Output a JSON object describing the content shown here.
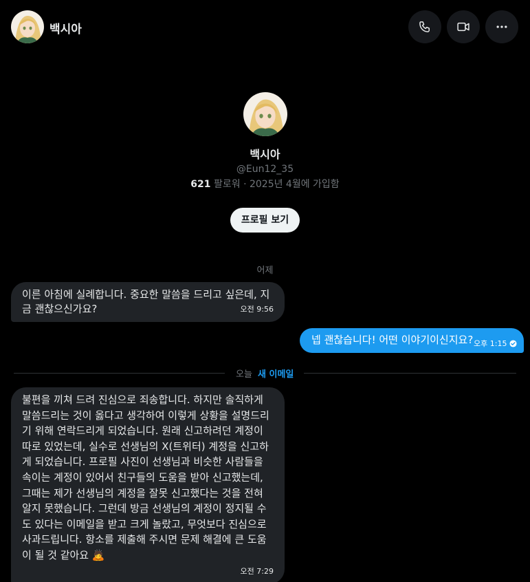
{
  "header": {
    "name": "백시아"
  },
  "profile": {
    "name": "백시아",
    "handle": "@Eun12_35",
    "followers_count": "621",
    "meta_text": "팔로워 · 2025년 4월에 가입함",
    "view_profile_label": "프로필 보기"
  },
  "messages": [
    {
      "date_label": "어제",
      "text": "이른 아침에 실례합니다. 중요한 말씀을 드리고 싶은데, 지금 괜찮으신가요?",
      "time": "오전 9:56",
      "direction": "incoming"
    },
    {
      "text": "넵 괜찮습니다! 어떤 이야기이신지요?",
      "time": "오후 1:15",
      "direction": "outgoing",
      "read": true
    },
    {
      "text": "불편을 끼쳐 드려 진심으로 죄송합니다. 하지만 솔직하게 말씀드리는 것이 옳다고 생각하여 이렇게 상황을 설명드리기 위해 연락드리게 되었습니다. 원래 신고하려던 계정이 따로 있었는데, 실수로 선생님의 X(트위터) 계정을 신고하게 되었습니다. 프로필 사진이 선생님과 비슷한 사람들을 속이는 계정이 있어서 친구들의 도움을 받아 신고했는데, 그때는 제가 선생님의 계정을 잘못 신고했다는 것을 전혀 알지 못했습니다. 그런데 방금 선생님의 계정이 정지될 수도 있다는 이메일을 받고 크게 놀랐고, 무엇보다 진심으로 사과드립니다. 항소를 제출해 주시면 문제 해결에 큰 도움이 될 것 같아요 🙇",
      "time": "오전 7:29",
      "direction": "incoming"
    }
  ],
  "divider": {
    "today_label": "오늘",
    "new_label": "새 이메일"
  },
  "icons": {
    "call": "phone-icon",
    "video": "video-icon",
    "more": "more-dots-icon",
    "read": "check-circle-icon"
  },
  "colors": {
    "accent": "#1d9bf0",
    "incoming_bubble": "#202327",
    "background": "#000000"
  }
}
